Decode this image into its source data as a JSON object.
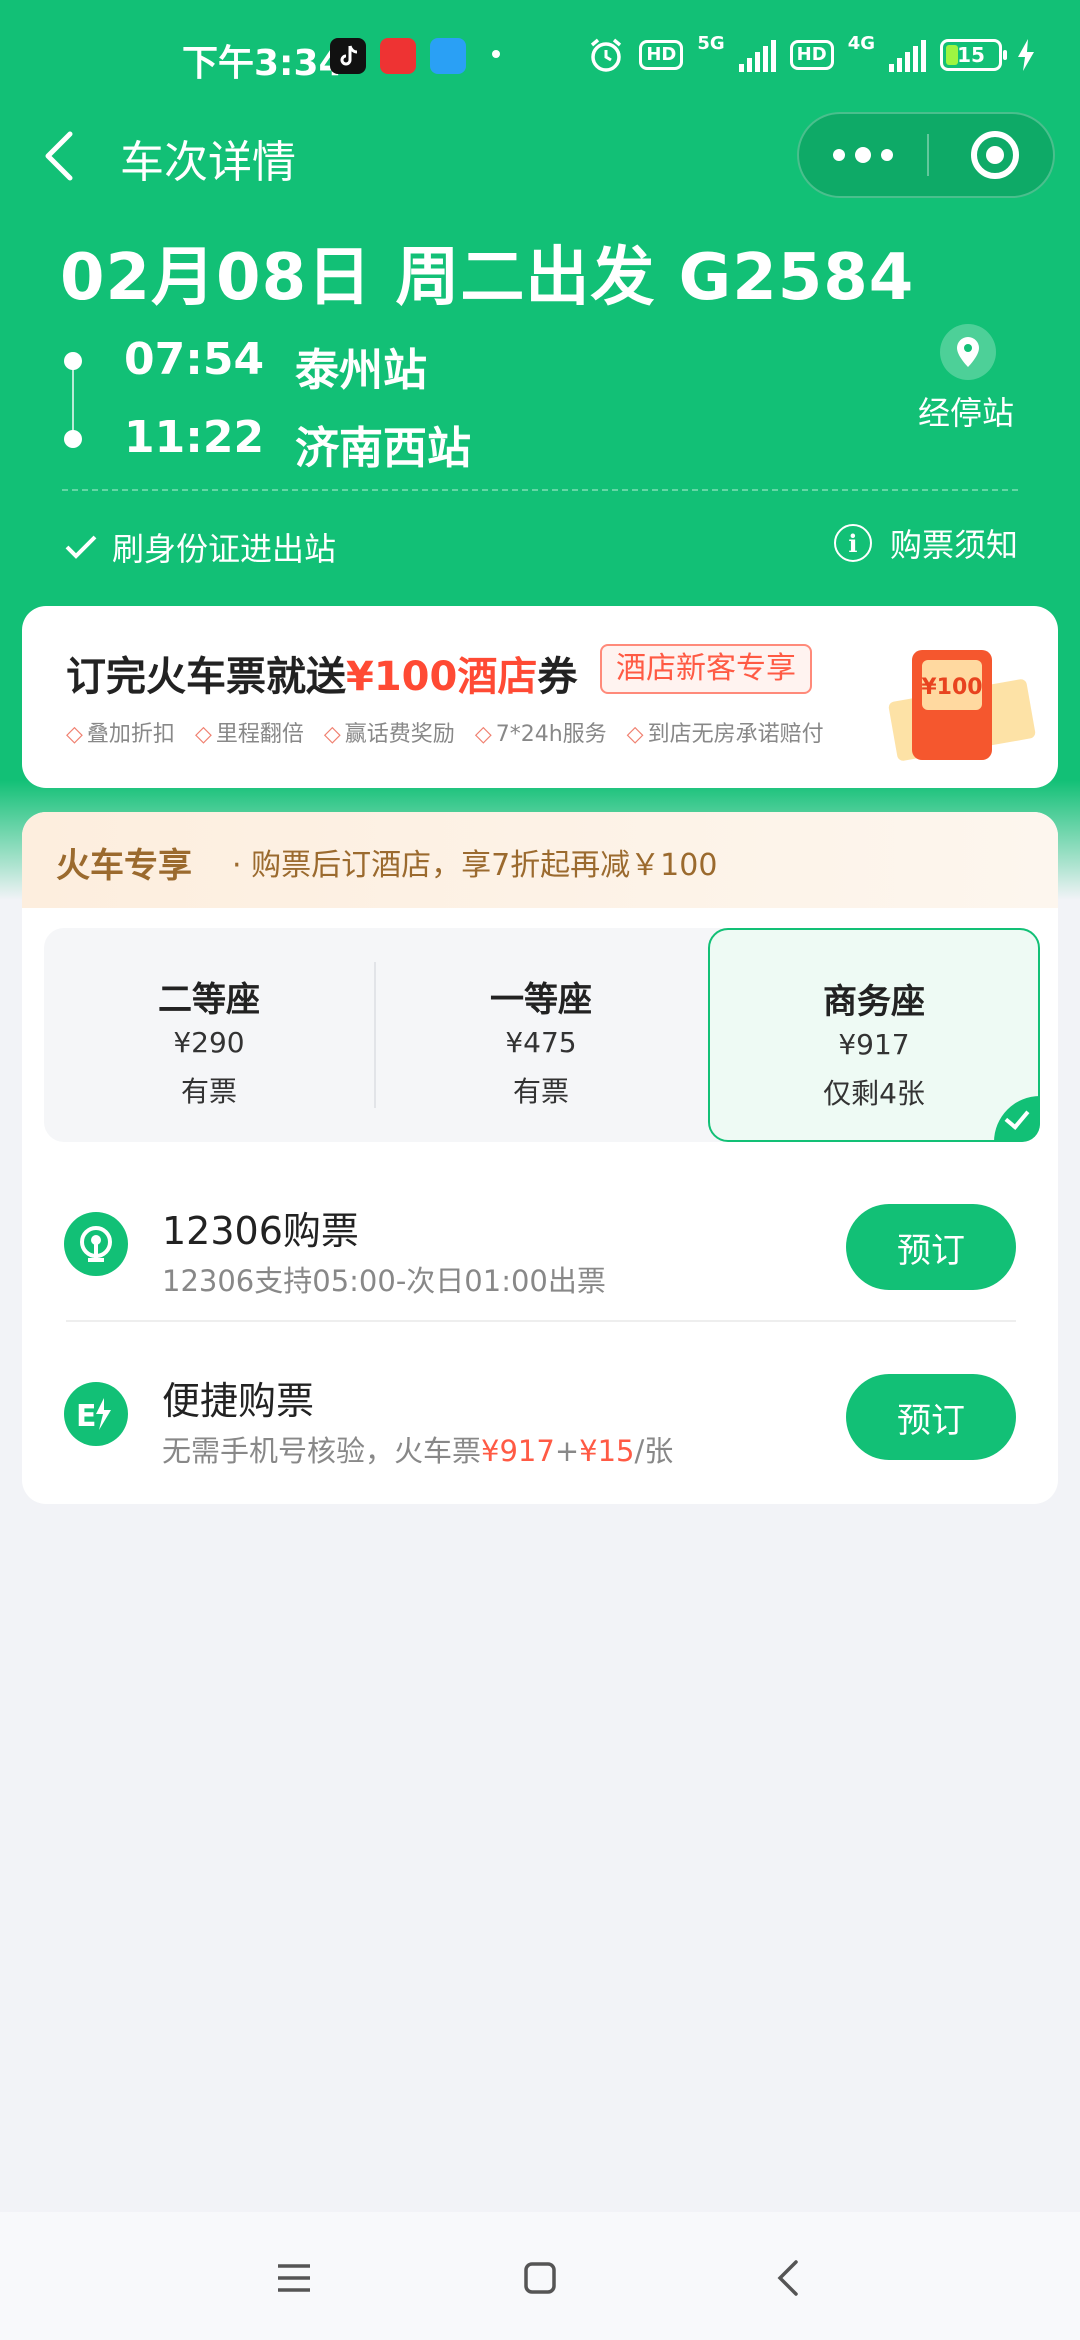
{
  "status_bar": {
    "time": "下午3:34",
    "hd1": "HD",
    "net1": "5G",
    "hd2": "HD",
    "net2": "4G",
    "battery": "15"
  },
  "nav": {
    "title": "车次详情"
  },
  "trip": {
    "title": "02月08日 周二出发 G2584",
    "depart_time": "07:54",
    "depart_station": "泰州站",
    "arrive_time": "11:22",
    "arrive_station": "济南西站",
    "stops_label": "经停站",
    "id_card_text": "刷身份证进出站",
    "notice_text": "购票须知"
  },
  "promo": {
    "headline_pre": "订完火车票就送",
    "headline_highlight": "¥100酒店",
    "headline_post": "券",
    "tag": "酒店新客专享",
    "features": [
      "叠加折扣",
      "里程翻倍",
      "赢话费奖励",
      "7*24h服务",
      "到店无房承诺赔付"
    ],
    "coupon_value": "¥100"
  },
  "exclusive": {
    "title": "火车专享",
    "text": "· 购票后订酒店，享7折起再减￥100"
  },
  "seats": [
    {
      "name": "二等座",
      "price": "¥290",
      "availability": "有票"
    },
    {
      "name": "一等座",
      "price": "¥475",
      "availability": "有票"
    },
    {
      "name": "商务座",
      "price": "¥917",
      "availability": "仅剩4张"
    }
  ],
  "purchase_options": [
    {
      "title": "12306购票",
      "subtitle": "12306支持05:00-次日01:00出票",
      "button": "预订"
    },
    {
      "title": "便捷购票",
      "subtitle_pre": "无需手机号核验，火车票",
      "price1": "¥917",
      "plus": "+",
      "price2": "¥15",
      "subtitle_post": "/张",
      "button": "预订"
    }
  ],
  "colors": {
    "brand_green": "#12c076",
    "promo_red": "#ff4a34",
    "exclusive_brown": "#9b6a2e"
  }
}
